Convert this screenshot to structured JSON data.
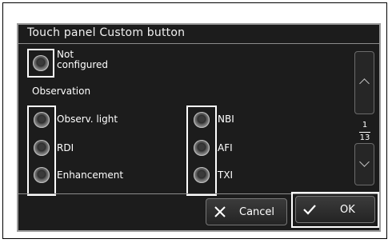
{
  "dialog": {
    "title": "Touch panel Custom button",
    "not_configured_label": "Not\nconfigured",
    "section_label": "Observation",
    "options_left": [
      "Observ. light",
      "RDI",
      "Enhancement"
    ],
    "options_right": [
      "NBI",
      "AFI",
      "TXI"
    ],
    "page_current": "1",
    "page_total": "13",
    "cancel_label": "Cancel",
    "ok_label": "OK"
  }
}
